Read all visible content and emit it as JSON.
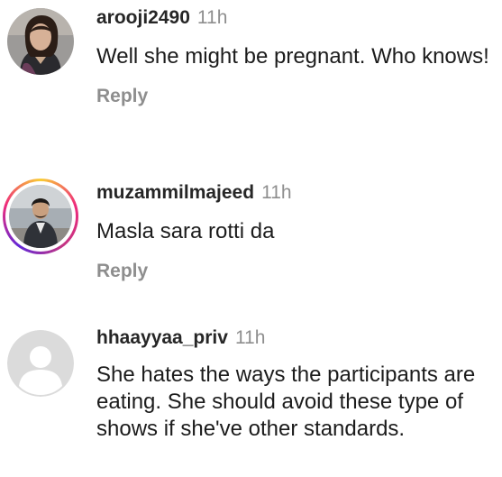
{
  "comments": [
    {
      "username": "arooji2490",
      "time": "11h",
      "text": "Well she might be pregnant. Who knows!",
      "reply_label": "Reply",
      "avatar": "profile-photo-woman",
      "story_ring": false
    },
    {
      "username": "muzammilmajeed",
      "time": "11h",
      "text": "Masla sara rotti da",
      "reply_label": "Reply",
      "avatar": "profile-photo-man",
      "story_ring": true
    },
    {
      "username": "hhaayyaa_priv",
      "time": "11h",
      "text": "She hates the ways the participants are eating. She should avoid these type of shows if she've other standards.",
      "reply_label": "",
      "avatar": "default-avatar-icon",
      "story_ring": false
    }
  ],
  "colors": {
    "username": "#262626",
    "meta": "#8e8e8e",
    "default_avatar_bg": "#dbdbdb",
    "default_avatar_fg": "#ffffff"
  }
}
